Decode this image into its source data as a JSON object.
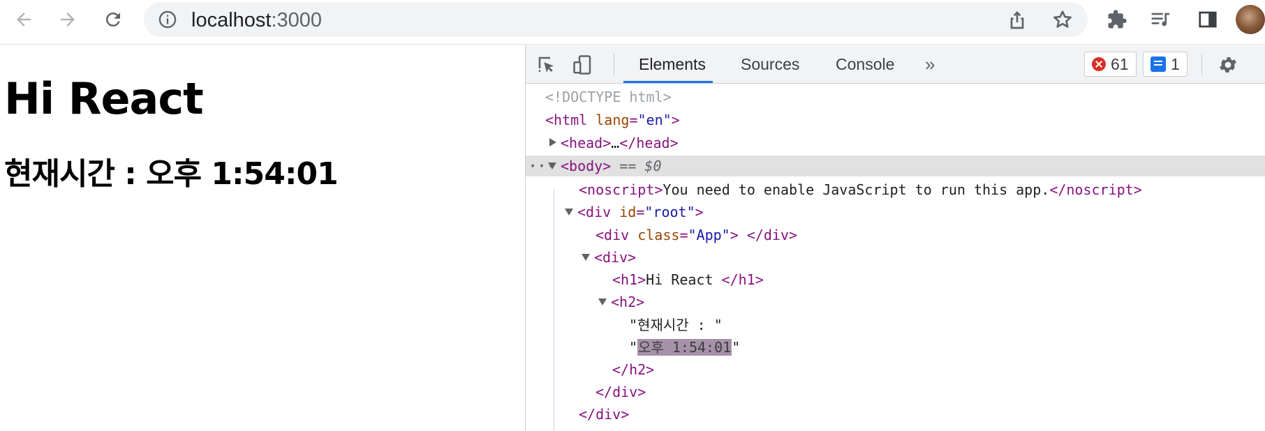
{
  "browser": {
    "url_host": "localhost",
    "url_port": ":3000"
  },
  "page": {
    "h1": "Hi React",
    "h2": "현재시간 : 오후 1:54:01"
  },
  "devtools": {
    "tabs": [
      "Elements",
      "Sources",
      "Console"
    ],
    "more_label": "»",
    "errors_count": "61",
    "messages_count": "1",
    "selected_suffix": "== $0",
    "dom": {
      "doctype": "<!DOCTYPE html>",
      "html_tag": "html",
      "html_attr": "lang",
      "html_val": "\"en\"",
      "head_open": "<head>",
      "head_ellipsis": "…",
      "head_close": "</head>",
      "body_tag": "<body>",
      "noscript_open": "<noscript>",
      "noscript_text": "You need to enable JavaScript to run this app.",
      "noscript_close": "</noscript>",
      "div_tag": "div",
      "id_attr": "id",
      "id_val": "\"root\"",
      "class_attr": "class",
      "class_val": "\"App\"",
      "div_close": "</div>",
      "div_open": "<div>",
      "h1_open": "<h1>",
      "h1_text": "Hi React ",
      "h1_close": "</h1>",
      "h2_open": "<h2>",
      "text_node_1": "\"현재시간 : \"",
      "text_node_2": "오후 1:54:01",
      "h2_close": "</h2>"
    }
  },
  "colors": {
    "tag": "#881280",
    "attr_name": "#994500",
    "attr_value": "#1a1aa6",
    "active_tab": "#1a73e8",
    "error": "#d93025"
  }
}
